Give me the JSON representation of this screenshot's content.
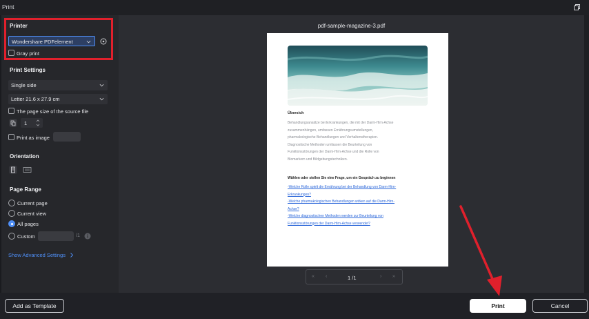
{
  "window": {
    "title": "Print"
  },
  "printer": {
    "section_title": "Printer",
    "selected": "Wondershare PDFelement",
    "gray_print_label": "Gray print"
  },
  "print_settings": {
    "section_title": "Print Settings",
    "sides": "Single side",
    "paper_size": "Letter 21.6 x 27.9 cm",
    "source_page_size_label": "The page size of the source file",
    "copies": "1",
    "print_as_image_label": "Print as image"
  },
  "orientation": {
    "section_title": "Orientation"
  },
  "page_range": {
    "section_title": "Page Range",
    "options": [
      "Current page",
      "Current view",
      "All pages",
      "Custom"
    ],
    "selected": "All pages",
    "custom_total": "/1"
  },
  "advanced_link": "Show Advanced Settings",
  "preview": {
    "file_name": "pdf-sample-magazine-3.pdf",
    "heading": "Übersich",
    "body_lines": [
      "Behandlungsansätze bei Erkrankungen, die mit der Darm-Hirn-Achse",
      "zusammenhängen, umfassen Ernährungsumstellungen,",
      "pharmakologische Behandlungen und Verhaltenstherapien.",
      "Diagnostische Methoden umfassen die Beurteilung von",
      "Funktionsstörungen der Darm-Hirn-Achse und die Rolle von",
      "Biomarkern und Bildgebungstechniken."
    ],
    "question": "Wählen oder stellen Sie eine Frage, um ein Gespräch zu beginnen",
    "link_lines": [
      "-Welche Rolle spielt die Ernährung bei der Behandlung von Darm-Hirn-",
      "Erkrankungen?",
      "-Welche pharmakologischen Behandlungen wirken auf die Darm-Hirn-",
      "Achse?",
      "-Welche diagnostischen Methoden werden zur Beurteilung von",
      "Funktionsstörungen der Darm-Hirn-Achse verwendet?"
    ],
    "page_indicator": "1 /1"
  },
  "footer": {
    "add_template_label": "Add as Template",
    "print_label": "Print",
    "cancel_label": "Cancel"
  },
  "colors": {
    "highlight_box": "#e0202c",
    "annotation_arrow": "#e0202c",
    "accent": "#4f8ff7"
  }
}
